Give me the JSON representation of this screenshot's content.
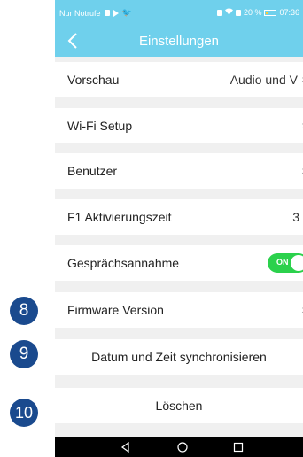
{
  "status_bar": {
    "carrier": "Nur Notrufe",
    "battery": "20 %",
    "time": "07:36"
  },
  "header": {
    "title": "Einstellungen",
    "back_icon": "chevron-left-icon"
  },
  "settings": {
    "preview": {
      "label": "Vorschau",
      "value": "Audio und V"
    },
    "wifi": {
      "label": "Wi-Fi Setup"
    },
    "user": {
      "label": "Benutzer"
    },
    "f1": {
      "label": "F1 Aktivierungszeit",
      "value": "3"
    },
    "call": {
      "label": "Gesprächsannahme",
      "toggle_text": "ON",
      "toggle_state": true
    },
    "firmware": {
      "label": "Firmware Version"
    },
    "sync": {
      "label": "Datum und Zeit synchronisieren"
    },
    "delete": {
      "label": "Löschen"
    }
  },
  "callouts": [
    "8",
    "9",
    "10"
  ],
  "colors": {
    "accent": "#6fd0ec",
    "toggle_on": "#2bd14c",
    "badge": "#1a4a8e"
  }
}
